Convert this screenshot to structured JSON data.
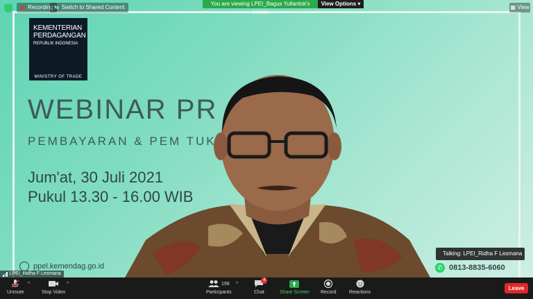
{
  "top": {
    "recording": "Recording",
    "switch": "Switch to Shared Content",
    "viewing_banner": "You are viewing LPEI_Bagus Yullantok's screen",
    "view_options": "View Options",
    "view_button": "View"
  },
  "slide": {
    "logo_line1": "KEMENTERIAN",
    "logo_line2": "PERDAGANGAN",
    "logo_line3": "REPUBLIK INDONESIA",
    "logo_footer": "MINISTRY OF TRADE",
    "title": "WEBINAR PR",
    "subtitle": "PEMBAYARAN & PEM              TUK EKSPOR",
    "date": "Jum'at, 30 Juli 2021",
    "time": "Pukul 13.30 - 16.00 WIB",
    "website": "ppel.kemendag.go.id",
    "whatsapp": "0813-8835-6060"
  },
  "overlay": {
    "talking": "Talking: LPEI_Ridha F Lesmana",
    "name_tag": "LPEI_Ridha F Lesmana"
  },
  "toolbar": {
    "unmute": "Unmute",
    "stop_video": "Stop Video",
    "participants": "Participants",
    "participants_count": "198",
    "chat": "Chat",
    "chat_badge": "4",
    "share_screen": "Share Screen",
    "record": "Record",
    "reactions": "Reactions",
    "leave": "Leave"
  },
  "colors": {
    "accent_green": "#2aaa4a",
    "leave_red": "#e02828",
    "slide_bg": "#7fdcc0"
  }
}
